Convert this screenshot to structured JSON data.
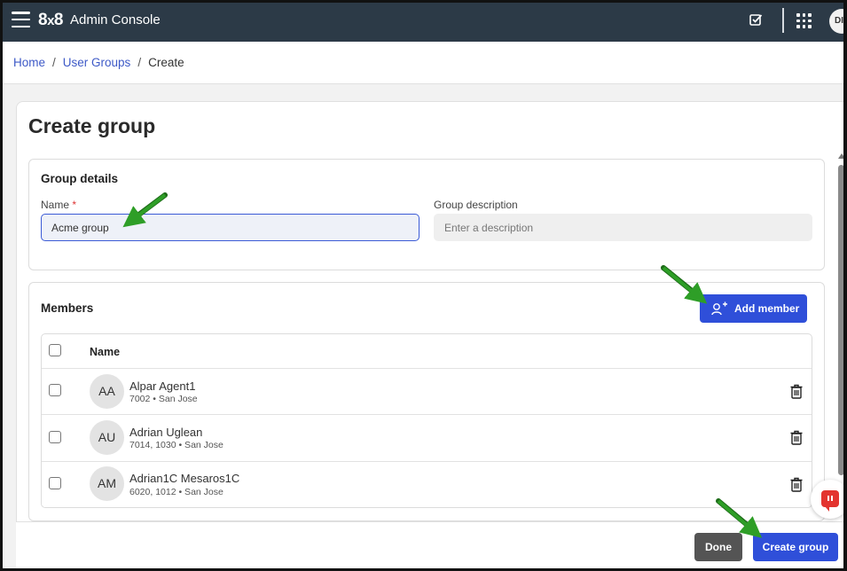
{
  "topbar": {
    "logo": "8x8",
    "title": "Admin Console",
    "avatar_initials": "DI"
  },
  "breadcrumb": {
    "home": "Home",
    "sep": "/",
    "user_groups": "User Groups",
    "current": "Create"
  },
  "page": {
    "title": "Create group"
  },
  "group_details": {
    "section_title": "Group details",
    "name_label": "Name",
    "required_mark": "*",
    "name_value": "Acme group",
    "description_label": "Group description",
    "description_placeholder": "Enter a description"
  },
  "members": {
    "section_title": "Members",
    "add_button": "Add member",
    "column_name": "Name",
    "rows": [
      {
        "initials": "AA",
        "name": "Alpar Agent1",
        "detail": "7002 • San Jose"
      },
      {
        "initials": "AU",
        "name": "Adrian Uglean",
        "detail": "7014, 1030 • San Jose"
      },
      {
        "initials": "AM",
        "name": "Adrian1C Mesaros1C",
        "detail": "6020, 1012 • San Jose"
      }
    ]
  },
  "footer": {
    "done_button": "Done",
    "create_button": "Create group"
  },
  "colors": {
    "topbar": "#2c3a47",
    "primary": "#2f4fd9",
    "link": "#3d59c7",
    "annotation_arrow": "#2e9e27"
  },
  "icons": [
    "menu-icon",
    "checkbox-square-icon",
    "apps-grid-icon",
    "add-person-icon",
    "trash-icon",
    "chat-icon"
  ]
}
